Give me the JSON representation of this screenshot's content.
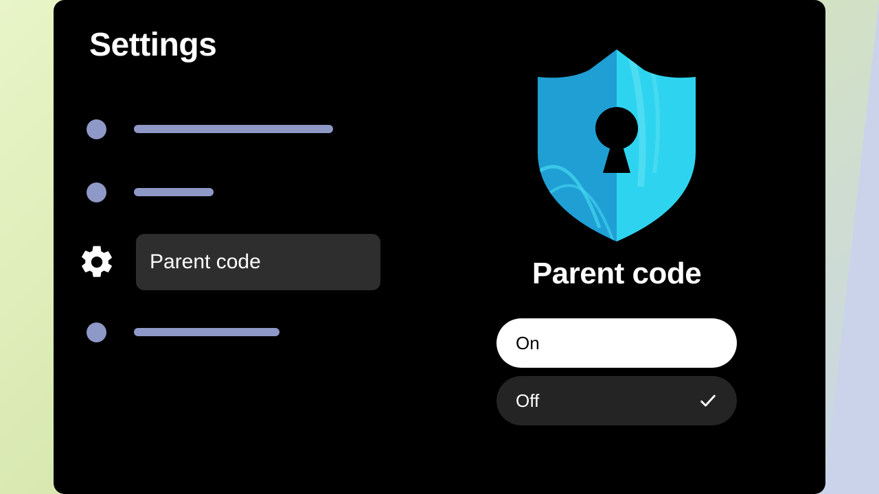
{
  "page_title": "Settings",
  "menu": {
    "active_label": "Parent code"
  },
  "detail": {
    "title": "Parent code",
    "options": {
      "on_label": "On",
      "off_label": "Off"
    }
  }
}
